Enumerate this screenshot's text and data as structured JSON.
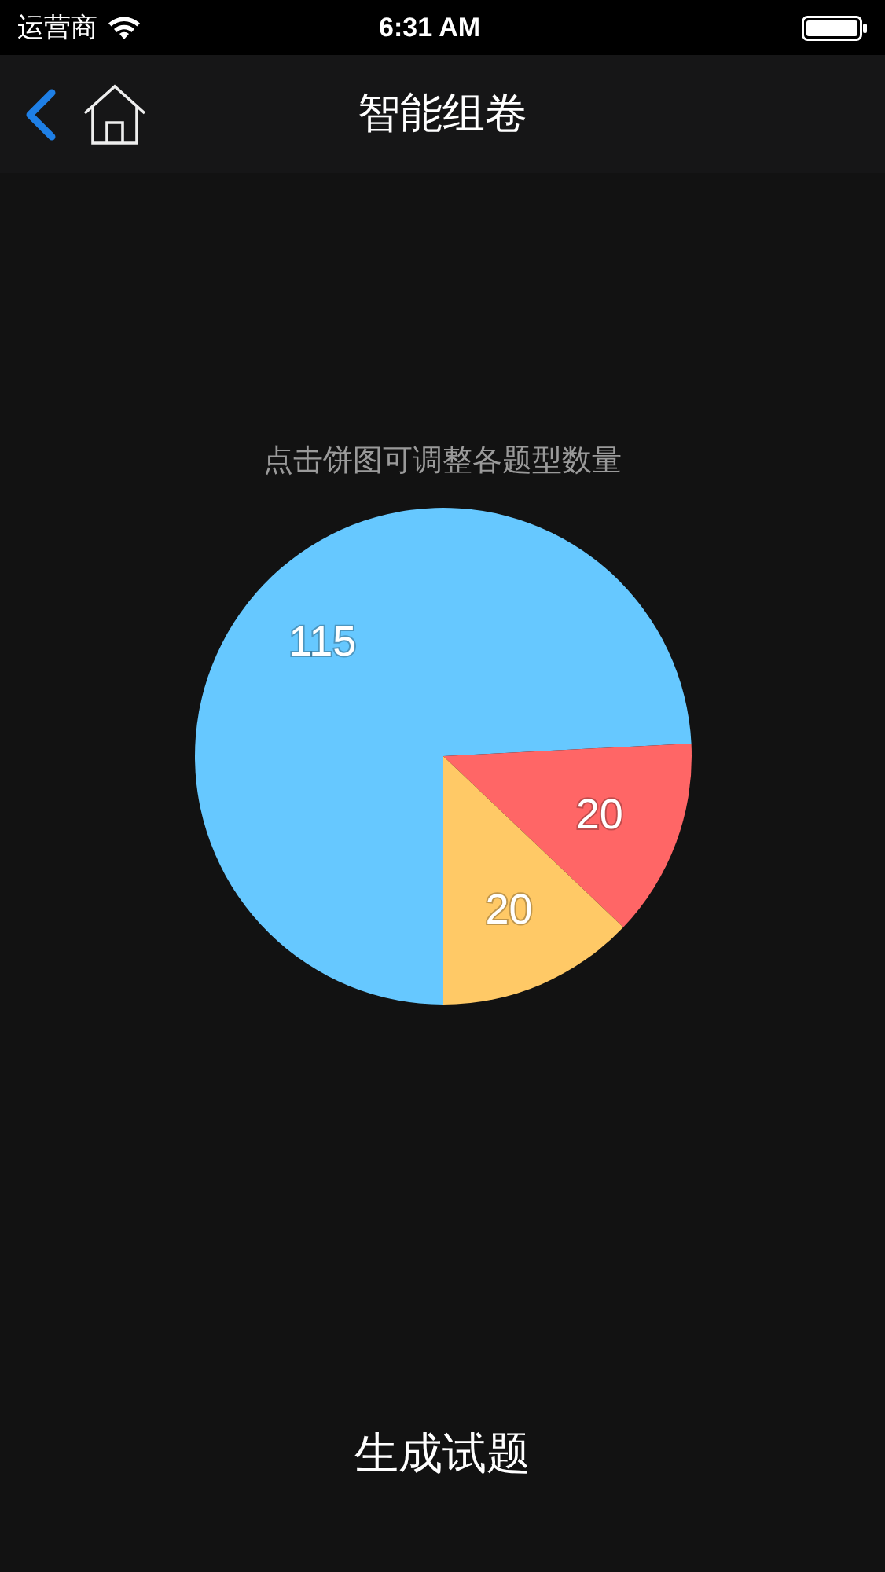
{
  "status_bar": {
    "carrier": "运营商",
    "time": "6:31 AM"
  },
  "nav": {
    "title": "智能组卷"
  },
  "hint": "点击饼图可调整各题型数量",
  "chart_data": {
    "type": "pie",
    "values": [
      115,
      20,
      20
    ],
    "colors": [
      "#66c8ff",
      "#ff6666",
      "#ffc966"
    ],
    "data_labels": true
  },
  "action": "生成试题"
}
